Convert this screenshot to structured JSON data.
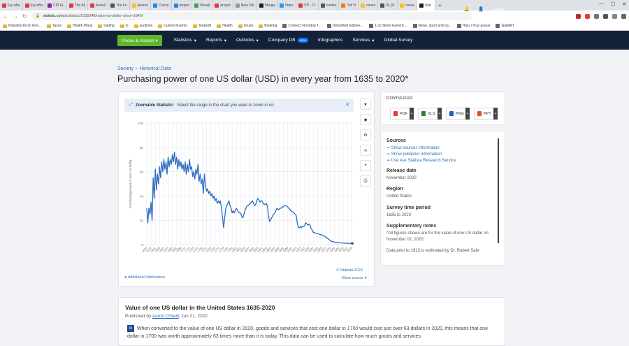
{
  "browser": {
    "tabs": [
      {
        "label": "Ety eBa",
        "color": "#e53935"
      },
      {
        "label": "Ety eBa",
        "color": "#e53935"
      },
      {
        "label": "CPI FL",
        "color": "#8e24aa"
      },
      {
        "label": "The All",
        "color": "#e53935"
      },
      {
        "label": "Anneli",
        "color": "#e53935"
      },
      {
        "label": "The Fo",
        "color": "#555555"
      },
      {
        "label": "Averac",
        "color": "#fbc02d"
      },
      {
        "label": "Conve",
        "color": "#1e88e5"
      },
      {
        "label": "propet",
        "color": "#1e88e5"
      },
      {
        "label": "Visuali",
        "color": "#43a047"
      },
      {
        "label": "propet",
        "color": "#e53935"
      },
      {
        "label": "New Tab",
        "color": "#999999"
      },
      {
        "label": "Marga",
        "color": "#222222"
      },
      {
        "label": "https:",
        "color": "#1da1f2"
      },
      {
        "label": "PP - Cr",
        "color": "#e53935"
      },
      {
        "label": "contex",
        "color": "#555555"
      },
      {
        "label": "Tell H",
        "color": "#f57c00"
      },
      {
        "label": "conve",
        "color": "#fbc02d"
      },
      {
        "label": "W_W",
        "color": "#555555"
      },
      {
        "label": "conve",
        "color": "#fbc02d"
      },
      {
        "label": "Stat",
        "color": "#222222",
        "active": true
      }
    ],
    "new_tab": "+",
    "url_host": "statista.com",
    "url_path": "/statistics/1032048/value-us-dollar-since-1640/",
    "bookmarks": [
      {
        "label": "Imported From Fire...",
        "type": "folder"
      },
      {
        "label": "Taxes",
        "type": "folder"
      },
      {
        "label": "Health Plans",
        "type": "folder"
      },
      {
        "label": "trading",
        "type": "folder"
      },
      {
        "label": "lo",
        "type": "folder"
      },
      {
        "label": "auctions",
        "type": "folder"
      },
      {
        "label": "Current Events",
        "type": "folder"
      },
      {
        "label": "TeraSoft",
        "type": "folder"
      },
      {
        "label": "Health",
        "type": "folder"
      },
      {
        "label": "house",
        "type": "folder"
      },
      {
        "label": "Banking",
        "type": "folder"
      },
      {
        "label": "Connect NonStop T...",
        "type": "page"
      },
      {
        "label": "Detoxified Iodine+...",
        "type": "page"
      },
      {
        "label": "1 oz Silver Generic...",
        "type": "page"
      },
      {
        "label": "News, sport and op...",
        "type": "page"
      },
      {
        "label": "Hulu | Your queue",
        "type": "page"
      },
      {
        "label": "GabAPI",
        "type": "page"
      }
    ]
  },
  "nav": {
    "prices_label": "Prices & Access",
    "items": [
      "Statistics",
      "Reports",
      "Outlooks",
      "Company DB",
      "Infographics",
      "Services",
      "Global Survey"
    ],
    "new_badge": "NEW",
    "login": "Login"
  },
  "breadcrumb": {
    "first": "Society",
    "sep": "›",
    "second": "Historical Data"
  },
  "page_title": "Purchasing power of one US dollar (USD) in every year from 1635 to 2020*",
  "zoom": {
    "bold": "Zoomable Statistic:",
    "text": "Select the range in the chart you want to zoom in on."
  },
  "chart_footer": {
    "additional": "Additional Information",
    "credit": "© Statista 2022",
    "show_source": "Show source"
  },
  "chart_data": {
    "type": "line",
    "ylabel": "Purchasing power of one US dollar",
    "xlabel": "",
    "ylim": [
      0,
      100
    ],
    "yticks": [
      0,
      20,
      40,
      60,
      80,
      100
    ],
    "grid": true,
    "legend": "none",
    "color": "#2b6cc4",
    "xticks": [
      "1635",
      "1643",
      "1651",
      "1659",
      "1667",
      "1675",
      "1683",
      "1691",
      "1699",
      "1707",
      "1715",
      "1723",
      "1731",
      "1739",
      "1747",
      "1755",
      "1763",
      "1771",
      "1779",
      "1787",
      "1795",
      "1803",
      "1811",
      "1819",
      "1827",
      "1835",
      "1843",
      "1851",
      "1859",
      "1867",
      "1875",
      "1883",
      "1891",
      "1899",
      "1907",
      "1915",
      "1923",
      "1931",
      "1939",
      "1947",
      "1955",
      "1963",
      "1971",
      "1979",
      "1987",
      "1995",
      "2003",
      "2011",
      "2019"
    ],
    "points": [
      [
        1635,
        30
      ],
      [
        1637,
        18
      ],
      [
        1639,
        30
      ],
      [
        1641,
        25
      ],
      [
        1643,
        35
      ],
      [
        1645,
        20
      ],
      [
        1647,
        55
      ],
      [
        1649,
        38
      ],
      [
        1651,
        62
      ],
      [
        1653,
        45
      ],
      [
        1655,
        58
      ],
      [
        1657,
        50
      ],
      [
        1659,
        64
      ],
      [
        1661,
        55
      ],
      [
        1663,
        68
      ],
      [
        1665,
        60
      ],
      [
        1667,
        70
      ],
      [
        1669,
        62
      ],
      [
        1671,
        68
      ],
      [
        1673,
        58
      ],
      [
        1675,
        72
      ],
      [
        1677,
        64
      ],
      [
        1679,
        70
      ],
      [
        1681,
        66
      ],
      [
        1683,
        74
      ],
      [
        1685,
        68
      ],
      [
        1687,
        76
      ],
      [
        1689,
        66
      ],
      [
        1691,
        72
      ],
      [
        1693,
        62
      ],
      [
        1695,
        70
      ],
      [
        1697,
        64
      ],
      [
        1699,
        68
      ],
      [
        1701,
        62
      ],
      [
        1703,
        66
      ],
      [
        1705,
        60
      ],
      [
        1707,
        68
      ],
      [
        1709,
        58
      ],
      [
        1711,
        66
      ],
      [
        1713,
        60
      ],
      [
        1715,
        70
      ],
      [
        1717,
        62
      ],
      [
        1719,
        64
      ],
      [
        1721,
        56
      ],
      [
        1723,
        60
      ],
      [
        1725,
        54
      ],
      [
        1727,
        62
      ],
      [
        1729,
        58
      ],
      [
        1731,
        66
      ],
      [
        1733,
        52
      ],
      [
        1735,
        58
      ],
      [
        1737,
        50
      ],
      [
        1739,
        54
      ],
      [
        1741,
        42
      ],
      [
        1743,
        58
      ],
      [
        1745,
        48
      ],
      [
        1747,
        44
      ],
      [
        1749,
        46
      ],
      [
        1751,
        42
      ],
      [
        1753,
        44
      ],
      [
        1755,
        40
      ],
      [
        1757,
        42
      ],
      [
        1759,
        38
      ],
      [
        1761,
        40
      ],
      [
        1763,
        36
      ],
      [
        1765,
        38
      ],
      [
        1767,
        34
      ],
      [
        1769,
        36
      ],
      [
        1771,
        34
      ],
      [
        1773,
        36
      ],
      [
        1775,
        30
      ],
      [
        1777,
        22
      ],
      [
        1779,
        14
      ],
      [
        1781,
        22
      ],
      [
        1783,
        30
      ],
      [
        1785,
        32
      ],
      [
        1787,
        34
      ],
      [
        1789,
        36
      ],
      [
        1791,
        32
      ],
      [
        1793,
        30
      ],
      [
        1795,
        26
      ],
      [
        1797,
        28
      ],
      [
        1799,
        26
      ],
      [
        1801,
        28
      ],
      [
        1803,
        30
      ],
      [
        1805,
        28
      ],
      [
        1807,
        27
      ],
      [
        1809,
        26
      ],
      [
        1811,
        26
      ],
      [
        1813,
        23
      ],
      [
        1815,
        22
      ],
      [
        1817,
        25
      ],
      [
        1819,
        28
      ],
      [
        1821,
        30
      ],
      [
        1823,
        32
      ],
      [
        1825,
        32
      ],
      [
        1827,
        33
      ],
      [
        1829,
        34
      ],
      [
        1831,
        35
      ],
      [
        1833,
        36
      ],
      [
        1835,
        34
      ],
      [
        1837,
        32
      ],
      [
        1839,
        33
      ],
      [
        1841,
        36
      ],
      [
        1843,
        38
      ],
      [
        1845,
        37
      ],
      [
        1847,
        35
      ],
      [
        1849,
        36
      ],
      [
        1851,
        36
      ],
      [
        1853,
        34
      ],
      [
        1855,
        33
      ],
      [
        1857,
        33
      ],
      [
        1859,
        34
      ],
      [
        1861,
        32
      ],
      [
        1863,
        24
      ],
      [
        1865,
        19
      ],
      [
        1867,
        20
      ],
      [
        1869,
        22
      ],
      [
        1871,
        24
      ],
      [
        1873,
        25
      ],
      [
        1875,
        26
      ],
      [
        1877,
        28
      ],
      [
        1879,
        30
      ],
      [
        1881,
        29
      ],
      [
        1883,
        29
      ],
      [
        1885,
        30
      ],
      [
        1887,
        30
      ],
      [
        1889,
        31
      ],
      [
        1891,
        31
      ],
      [
        1893,
        32
      ],
      [
        1895,
        32
      ],
      [
        1897,
        32
      ],
      [
        1899,
        31
      ],
      [
        1901,
        30
      ],
      [
        1903,
        29
      ],
      [
        1905,
        28
      ],
      [
        1907,
        27
      ],
      [
        1909,
        27
      ],
      [
        1911,
        26
      ],
      [
        1913,
        25
      ],
      [
        1915,
        24
      ],
      [
        1917,
        18
      ],
      [
        1919,
        14
      ],
      [
        1921,
        14
      ],
      [
        1923,
        15
      ],
      [
        1925,
        14
      ],
      [
        1927,
        15
      ],
      [
        1929,
        15
      ],
      [
        1931,
        16
      ],
      [
        1933,
        18
      ],
      [
        1935,
        17
      ],
      [
        1937,
        16
      ],
      [
        1939,
        17
      ],
      [
        1941,
        16
      ],
      [
        1943,
        13
      ],
      [
        1945,
        12
      ],
      [
        1947,
        10
      ],
      [
        1949,
        10
      ],
      [
        1951,
        9.5
      ],
      [
        1953,
        9.3
      ],
      [
        1955,
        9.2
      ],
      [
        1957,
        8.8
      ],
      [
        1959,
        8.5
      ],
      [
        1961,
        8.2
      ],
      [
        1963,
        8
      ],
      [
        1965,
        7.8
      ],
      [
        1967,
        7.3
      ],
      [
        1969,
        6.7
      ],
      [
        1971,
        6
      ],
      [
        1973,
        5.4
      ],
      [
        1975,
        4.6
      ],
      [
        1977,
        4
      ],
      [
        1979,
        3.4
      ],
      [
        1981,
        2.7
      ],
      [
        1983,
        2.4
      ],
      [
        1985,
        2.3
      ],
      [
        1987,
        2.1
      ],
      [
        1989,
        1.95
      ],
      [
        1991,
        1.8
      ],
      [
        1993,
        1.7
      ],
      [
        1995,
        1.6
      ],
      [
        1997,
        1.5
      ],
      [
        1999,
        1.45
      ],
      [
        2001,
        1.4
      ],
      [
        2003,
        1.3
      ],
      [
        2005,
        1.25
      ],
      [
        2007,
        1.15
      ],
      [
        2009,
        1.12
      ],
      [
        2011,
        1.08
      ],
      [
        2013,
        1.05
      ],
      [
        2015,
        1.03
      ],
      [
        2017,
        1.01
      ],
      [
        2019,
        1
      ],
      [
        2020,
        1
      ]
    ]
  },
  "download": {
    "title": "DOWNLOAD",
    "buttons": [
      {
        "label": "PDF",
        "color": "#e53935"
      },
      {
        "label": "XLS",
        "color": "#2e7d32"
      },
      {
        "label": "PNG",
        "color": "#1565c0"
      },
      {
        "label": "PPT",
        "color": "#e64a19"
      }
    ],
    "plus": "+"
  },
  "info": {
    "sources_head": "Sources",
    "sources_links": [
      "Show sources information",
      "Show publisher information",
      "Use Ask Statista Research Service"
    ],
    "release_head": "Release date",
    "release_val": "November 2020",
    "region_head": "Region",
    "region_val": "United States",
    "period_head": "Survey time period",
    "period_val": "1635 to 2020",
    "notes_head": "Supplementary notes",
    "notes_val": "*All figures shown are for the value of one US dollar on November 02, 2020.",
    "notes_val2": "Data prior to 1913 is estimated by Dr. Robert Sahr"
  },
  "article": {
    "title": "Value of one US dollar in the United States 1635-2020",
    "published_prefix": "Published by",
    "author": "Aaron O'Neill",
    "date": ", Jun 21, 2022",
    "icon": "lıı",
    "body": "When converted to the value of one US dollar in 2020, goods and services that cost one dollar in 1700 would cost just over 63 dollars in 2020, this means that one dollar in 1700 was worth approximately 63 times more than it is today. This data can be used to calculate how much goods and services"
  }
}
